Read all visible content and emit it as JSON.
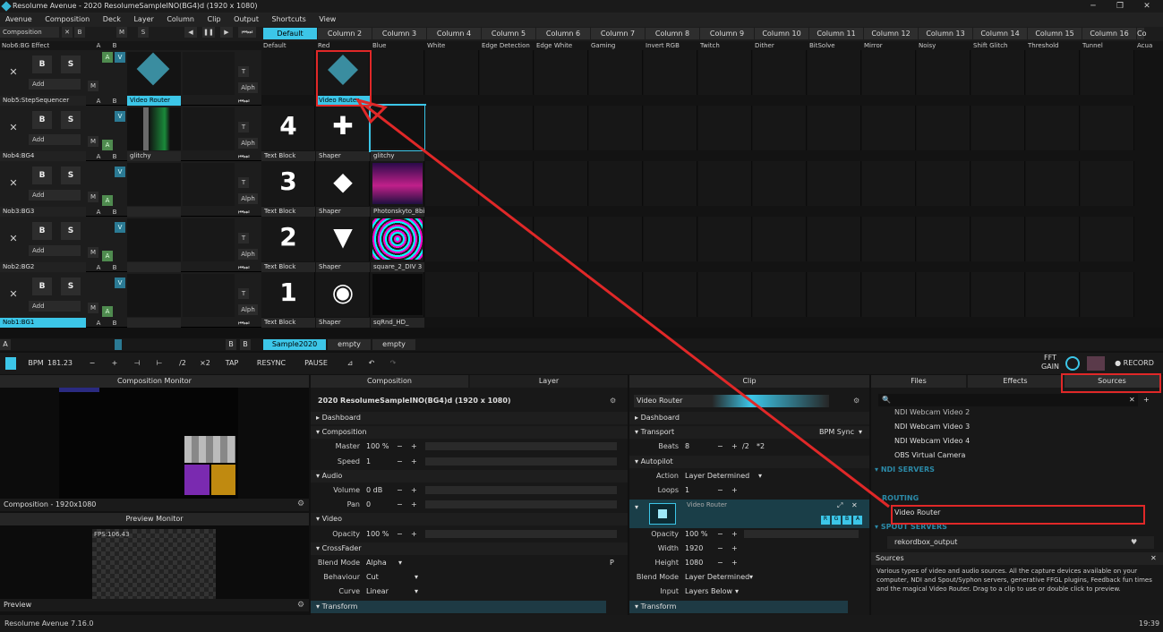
{
  "window": {
    "title": "Resolume Avenue - 2020 ResolumeSampleINO(BG4)d (1920 x 1080)",
    "min": "─",
    "max": "❐",
    "close": "✕"
  },
  "menu": [
    "Avenue",
    "Composition",
    "Deck",
    "Layer",
    "Column",
    "Clip",
    "Output",
    "Shortcuts",
    "View"
  ],
  "colheader": {
    "composition": "Composition",
    "x": "✕",
    "b": "B",
    "m": "M",
    "s": "S"
  },
  "columns": [
    "Default",
    "Column 2",
    "Column 3",
    "Column 4",
    "Column 5",
    "Column 6",
    "Column 7",
    "Column 8",
    "Column 9",
    "Column 10",
    "Column 11",
    "Column 12",
    "Column 13",
    "Column 14",
    "Column 15",
    "Column 16",
    "Co"
  ],
  "clipnames_top": [
    "Default",
    "Red",
    "Blue",
    "White",
    "Edge Detection",
    "Edge White",
    "Gaming",
    "Invert RGB",
    "Twitch",
    "Dither",
    "BitSolve",
    "Mirror",
    "Noisy",
    "Shift Glitch",
    "Threshold",
    "Tunnel",
    "Acua"
  ],
  "layer_top_name": "Nob6:BG Effect",
  "layers": [
    {
      "name": "Nob5:StepSequencer",
      "thumb": "Video Router",
      "b": "B",
      "s": "S",
      "add": "Add",
      "m": "M",
      "a": "A",
      "v": "V",
      "t": "T",
      "alph": "Alph",
      "x": "✕"
    },
    {
      "name": "Nob4:BG4",
      "thumb": "glitchy",
      "b": "B",
      "s": "S",
      "add": "Add",
      "m": "M",
      "a": "A",
      "v": "V",
      "t": "T",
      "alph": "Alph",
      "x": "✕"
    },
    {
      "name": "Nob3:BG3",
      "thumb": "",
      "b": "B",
      "s": "S",
      "add": "Add",
      "m": "M",
      "a": "A",
      "v": "V",
      "t": "T",
      "alph": "Alph",
      "x": "✕"
    },
    {
      "name": "Nob2:BG2",
      "thumb": "",
      "b": "B",
      "s": "S",
      "add": "Add",
      "m": "M",
      "a": "A",
      "v": "V",
      "t": "T",
      "alph": "Alph",
      "x": "✕"
    },
    {
      "name": "Nob1:BG1",
      "thumb": "",
      "b": "B",
      "s": "S",
      "add": "Add",
      "m": "M",
      "a": "A",
      "v": "V",
      "t": "T",
      "alph": "Alph",
      "x": "✕"
    }
  ],
  "clips": {
    "r1": [
      "",
      "Video Router",
      "",
      "",
      "",
      ""
    ],
    "r2": [
      {
        "num": "4",
        "label": "Text Block"
      },
      {
        "glyph": "✚",
        "label": "Shaper"
      },
      {
        "label": "glitchy"
      }
    ],
    "r3": [
      {
        "num": "3",
        "label": "Text Block"
      },
      {
        "glyph": "◆",
        "label": "Shaper"
      },
      {
        "label": "Photonskyto_8bit..."
      }
    ],
    "r4": [
      {
        "num": "2",
        "label": "Text Block"
      },
      {
        "glyph": "▼",
        "label": "Shaper"
      },
      {
        "label": "square_2_DIV 3 N..."
      }
    ],
    "r5": [
      {
        "num": "1",
        "label": "Text Block"
      },
      {
        "glyph": "◉",
        "label": "Shaper"
      },
      {
        "label": "sqRnd_HD_"
      }
    ]
  },
  "decks": {
    "a": "A",
    "b": "B",
    "deck1": "Sample2020",
    "deck2": "empty",
    "deck3": "empty"
  },
  "toolbar": {
    "bpm_label": "BPM",
    "bpm": "181.23",
    "minus": "−",
    "plus": "+",
    "nudge_l": "⊣",
    "nudge_r": "⊢",
    "half": "/2",
    "double": "×2",
    "tap": "TAP",
    "resync": "RESYNC",
    "pause": "PAUSE",
    "fft": "FFT",
    "gain": "GAIN",
    "record": "● RECORD"
  },
  "monitors": {
    "comp": "Composition Monitor",
    "comp_res": "Composition - 1920x1080",
    "preview": "Preview Monitor",
    "fps": "FPS:106.43",
    "preview_lbl": "Preview"
  },
  "comp_panel": {
    "tab1": "Composition",
    "tab2": "Layer",
    "title": "2020 ResolumeSampleINO(BG4)d (1920 x 1080)",
    "dashboard": "Dashboard",
    "composition": "Composition",
    "master_label": "Master",
    "master": "100 %",
    "speed_label": "Speed",
    "speed": "1",
    "audio": "Audio",
    "volume_label": "Volume",
    "volume": "0 dB",
    "pan_label": "Pan",
    "pan": "0",
    "video": "Video",
    "opacity_label": "Opacity",
    "opacity": "100 %",
    "crossfader": "CrossFader",
    "blend_label": "Blend Mode",
    "blend": "Alpha",
    "behaviour_label": "Behaviour",
    "behaviour": "Cut",
    "curve_label": "Curve",
    "curve": "Linear",
    "transform": "Transform"
  },
  "clip_panel": {
    "tab": "Clip",
    "name": "Video Router",
    "dashboard": "Dashboard",
    "transport": "Transport",
    "bpmsync": "BPM Sync",
    "beats_label": "Beats",
    "beats": "8",
    "half": "/2",
    "dbl": "*2",
    "autopilot": "Autopilot",
    "action_label": "Action",
    "action": "Layer Determined",
    "loops_label": "Loops",
    "loops": "1",
    "effect_name": "Video Router",
    "rgba": [
      "R",
      "G",
      "B",
      "A"
    ],
    "opacity_label": "Opacity",
    "opacity": "100 %",
    "width_label": "Width",
    "width": "1920",
    "height_label": "Height",
    "height": "1080",
    "blend_label": "Blend Mode",
    "blend": "Layer Determined",
    "input_label": "Input",
    "input": "Layers Below",
    "transform": "Transform"
  },
  "sources_panel": {
    "tabs": [
      "Files",
      "Effects",
      "Sources"
    ],
    "items": [
      "NDI Webcam Video 2",
      "NDI Webcam Video 3",
      "NDI Webcam Video 4",
      "OBS Virtual Camera"
    ],
    "ndi_servers": "NDI SERVERS",
    "routing": "ROUTING",
    "video_router": "Video Router",
    "spout_servers": "SPOUT SERVERS",
    "rekordbox": "rekordbox_output",
    "help_title": "Sources",
    "help_text": "Various types of video and audio sources. All the capture devices available on your computer, NDI and Spout/Syphon servers, generative FFGL plugins, Feedback fun times and the magical Video Router. Drag to a clip to use or double click to preview."
  },
  "status": {
    "version": "Resolume Avenue 7.16.0",
    "time": "19:39"
  },
  "colors": {
    "accent": "#3cc6e8",
    "annotation": "#e02828"
  }
}
